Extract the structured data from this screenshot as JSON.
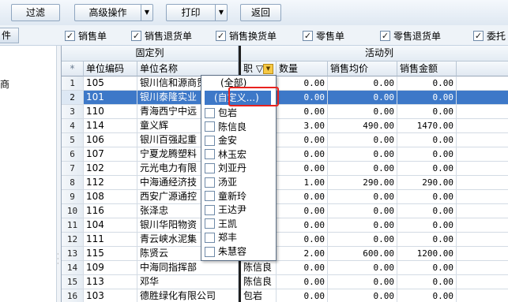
{
  "toolbar": {
    "filter_label": "过滤",
    "advanced_label": "高级操作",
    "print_label": "打印",
    "back_label": "返回"
  },
  "side_tab_label": "件",
  "left_fragment": "商",
  "filters": [
    {
      "label": "销售单",
      "checked": true
    },
    {
      "label": "销售退货单",
      "checked": true
    },
    {
      "label": "销售换货单",
      "checked": true
    },
    {
      "label": "零售单",
      "checked": true
    },
    {
      "label": "零售退货单",
      "checked": true
    },
    {
      "label": "委托",
      "checked": true
    }
  ],
  "grid": {
    "fixed_band": "固定列",
    "active_band": "活动列",
    "row_header_symbol": "*",
    "columns": {
      "code": "单位编码",
      "name": "单位名称",
      "person": "职 ▽",
      "qty": "数量",
      "avg_price": "销售均价",
      "amount": "销售金额"
    },
    "rows": [
      {
        "n": "1",
        "code": "105",
        "name": "银川信和源商贸",
        "person": "",
        "qty": "0.00",
        "avg": "0.00",
        "amt": "0.00"
      },
      {
        "n": "2",
        "code": "101",
        "name": "银川泰隆实业",
        "person": "",
        "qty": "0.00",
        "avg": "0.00",
        "amt": "0.00"
      },
      {
        "n": "3",
        "code": "110",
        "name": "青海西宁中远",
        "person": "",
        "qty": "0.00",
        "avg": "0.00",
        "amt": "0.00"
      },
      {
        "n": "4",
        "code": "114",
        "name": "童义辉",
        "person": "",
        "qty": "3.00",
        "avg": "490.00",
        "amt": "1470.00"
      },
      {
        "n": "5",
        "code": "106",
        "name": "银川百强起重",
        "person": "",
        "qty": "0.00",
        "avg": "0.00",
        "amt": "0.00"
      },
      {
        "n": "6",
        "code": "107",
        "name": "宁夏龙腾塑料",
        "person": "",
        "qty": "0.00",
        "avg": "0.00",
        "amt": "0.00"
      },
      {
        "n": "7",
        "code": "102",
        "name": "元光电力有限",
        "person": "",
        "qty": "0.00",
        "avg": "0.00",
        "amt": "0.00"
      },
      {
        "n": "8",
        "code": "112",
        "name": "中海通经济技",
        "person": "",
        "qty": "1.00",
        "avg": "290.00",
        "amt": "290.00"
      },
      {
        "n": "9",
        "code": "108",
        "name": "西安广源通控",
        "person": "",
        "qty": "0.00",
        "avg": "0.00",
        "amt": "0.00"
      },
      {
        "n": "10",
        "code": "116",
        "name": "张泽忠",
        "person": "",
        "qty": "0.00",
        "avg": "0.00",
        "amt": "0.00"
      },
      {
        "n": "11",
        "code": "104",
        "name": "银川华阳物资",
        "person": "",
        "qty": "0.00",
        "avg": "0.00",
        "amt": "0.00"
      },
      {
        "n": "12",
        "code": "111",
        "name": "青云峡水泥集",
        "person": "",
        "qty": "0.00",
        "avg": "0.00",
        "amt": "0.00"
      },
      {
        "n": "13",
        "code": "115",
        "name": "陈贤云",
        "person": "",
        "qty": "2.00",
        "avg": "600.00",
        "amt": "1200.00"
      },
      {
        "n": "14",
        "code": "109",
        "name": "中海同指挥部",
        "person": "陈信良",
        "qty": "0.00",
        "avg": "0.00",
        "amt": "0.00"
      },
      {
        "n": "15",
        "code": "113",
        "name": "邓华",
        "person": "陈信良",
        "qty": "0.00",
        "avg": "0.00",
        "amt": "0.00"
      },
      {
        "n": "16",
        "code": "103",
        "name": "德胜绿化有限公司",
        "person": "包岩",
        "qty": "0.00",
        "avg": "0.00",
        "amt": "0.00"
      }
    ]
  },
  "dropdown": {
    "all_label": "(全部)",
    "custom_label": "(自定义...)",
    "options": [
      "包岩",
      "陈信良",
      "金安",
      "林玉宏",
      "刘亚丹",
      "汤亚",
      "童新玲",
      "王达尹",
      "王凯",
      "郑丰",
      "朱慧容"
    ]
  },
  "colors": {
    "selection": "#3d78c8",
    "highlight_border": "#e8221e",
    "filter_icon": "#f6c945"
  }
}
